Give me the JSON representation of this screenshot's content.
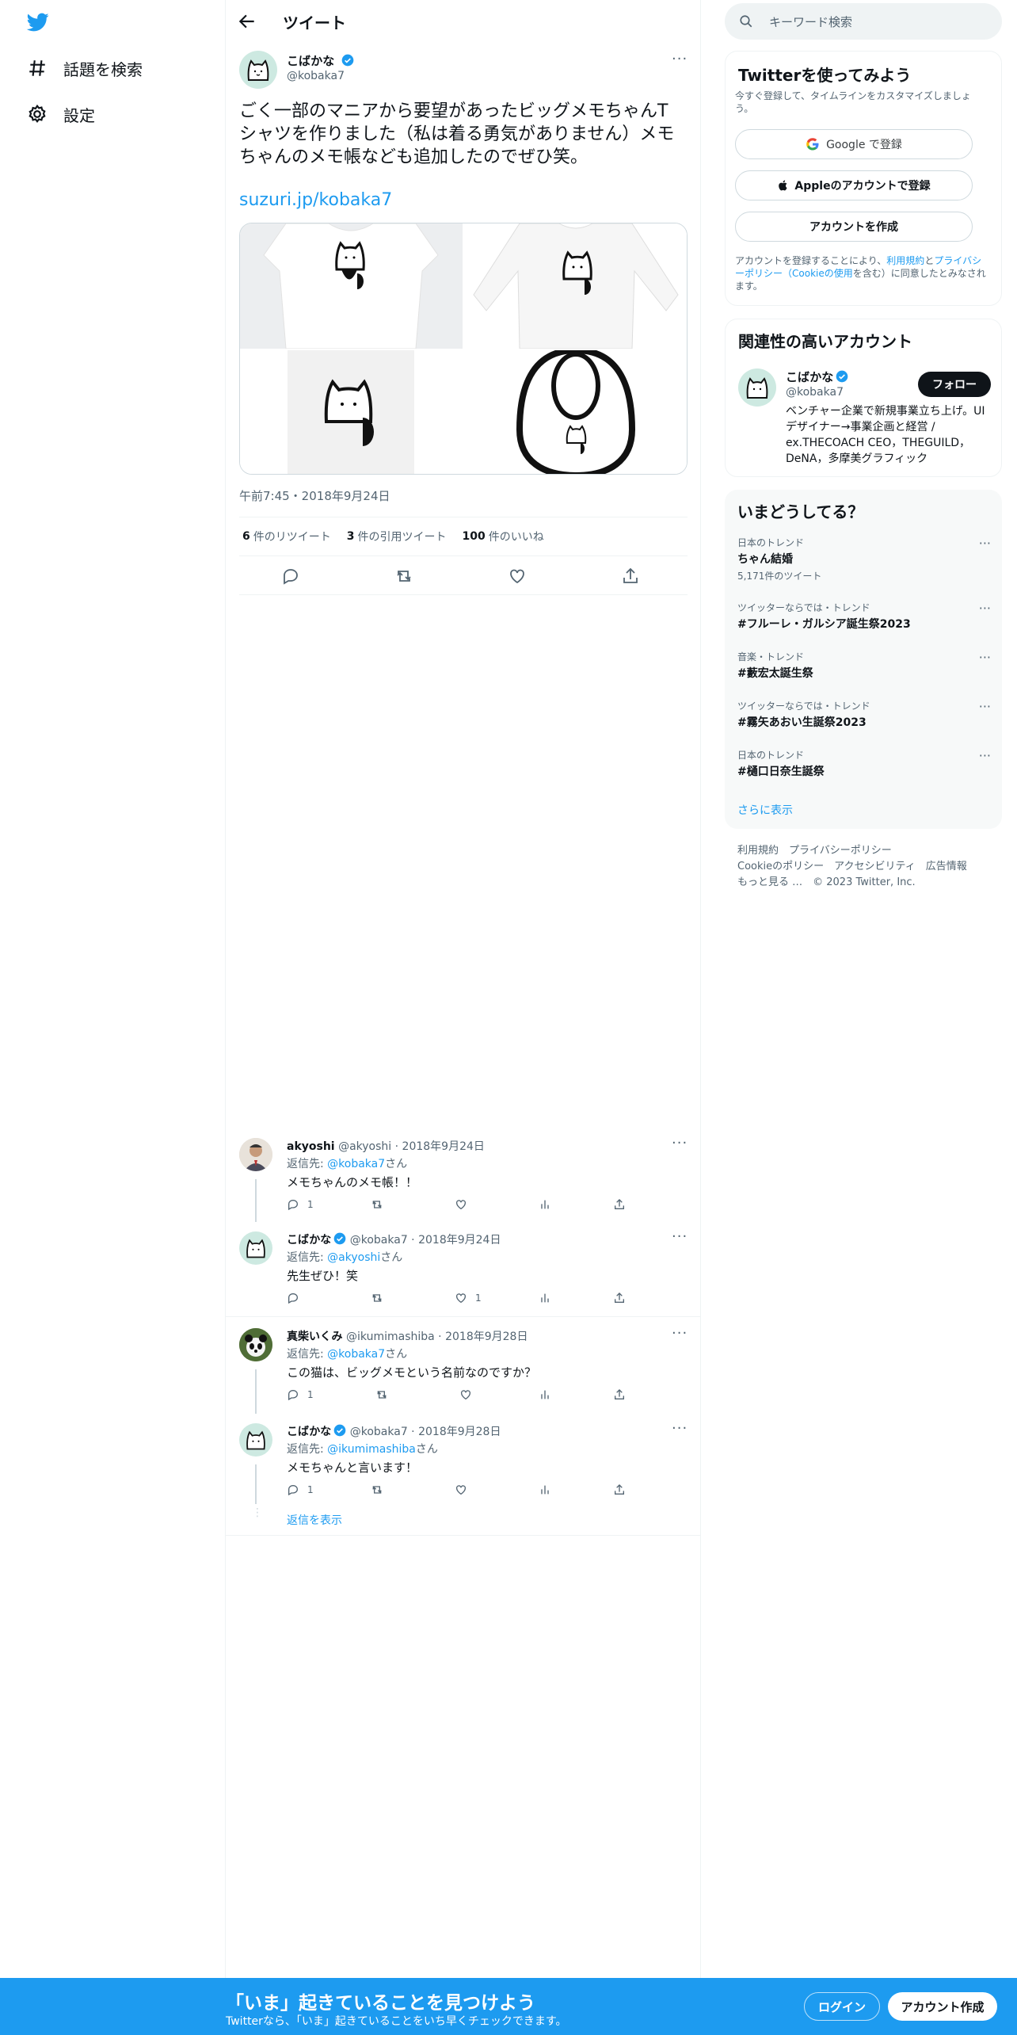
{
  "nav": {
    "explore_label": "話題を検索",
    "settings_label": "設定"
  },
  "header": {
    "title": "ツイート"
  },
  "tweet": {
    "author_name": "こばかな",
    "author_handle": "@kobaka7",
    "text": "ごく一部のマニアから要望があったビッグメモちゃんTシャツを作りました（私は着る勇気がありません）メモちゃんのメモ帳なども追加したのでぜひ笑。",
    "link": "suzuri.jp/kobaka7",
    "timestamp": "午前7:45・2018年9月24日",
    "retweets": "6",
    "retweets_label": "件のリツイート",
    "quotes": "3",
    "quotes_label": "件の引用ツイート",
    "likes": "100",
    "likes_label": "件のいいね",
    "more_label": "···"
  },
  "replies": [
    {
      "name": "akyoshi",
      "handle": "@akyoshi",
      "date": "2018年9月24日",
      "reply_to_prefix": "返信先: ",
      "reply_to": "@kobaka7",
      "reply_to_suffix": "さん",
      "text": "メモちゃんのメモ帳！！",
      "reply_count": "1",
      "retweet_count": "",
      "like_count": ""
    },
    {
      "name": "こばかな",
      "handle": "@kobaka7",
      "date": "2018年9月24日",
      "reply_to_prefix": "返信先: ",
      "reply_to": "@akyoshi",
      "reply_to_suffix": "さん",
      "text": "先生ぜひ！笑",
      "reply_count": "",
      "retweet_count": "",
      "like_count": "1"
    },
    {
      "name": "真柴いくみ",
      "handle": "@ikumimashiba",
      "date": "2018年9月28日",
      "reply_to_prefix": "返信先: ",
      "reply_to": "@kobaka7",
      "reply_to_suffix": "さん",
      "text": "この猫は、ビッグメモという名前なのですか？",
      "reply_count": "1",
      "retweet_count": "",
      "like_count": ""
    },
    {
      "name": "こばかな",
      "handle": "@kobaka7",
      "date": "2018年9月28日",
      "reply_to_prefix": "返信先: ",
      "reply_to": "@ikumimashiba",
      "reply_to_suffix": "さん",
      "text": "メモちゃんと言います！",
      "reply_count": "1",
      "retweet_count": "",
      "like_count": ""
    }
  ],
  "show_replies_label": "返信を表示",
  "right": {
    "search_placeholder": "キーワード検索",
    "signup_box": {
      "title": "Twitterを使ってみよう",
      "subtitle": "今すぐ登録して、タイムラインをカスタマイズしましょう。",
      "google_label": "Google で登録",
      "apple_label": "Appleのアカウントで登録",
      "create_label": "アカウントを作成",
      "terms_prefix": "アカウントを登録することにより、",
      "terms_link": "利用規約",
      "terms_and": "と",
      "privacy_link": "プライバシーポリシー",
      "terms_paren_open": "（",
      "cookie_link": "Cookieの使用",
      "terms_suffix": "を含む）に同意したとみなされます。"
    },
    "related": {
      "title": "関連性の高いアカウント",
      "name": "こばかな",
      "handle": "@kobaka7",
      "follow_label": "フォロー",
      "bio": "ベンチャー企業で新規事業立ち上げ。UIデザイナー→事業企画と経営 / ex.THECOACH CEO，THEGUILD，DeNA，多摩美グラフィック"
    },
    "trends": {
      "title": "いまどうしてる？",
      "items": [
        {
          "meta": "日本のトレンド",
          "name": "ちゃん結婚",
          "count": "5,171件のツイート"
        },
        {
          "meta": "ツイッターならでは・トレンド",
          "name": "#フルーレ・ガルシア誕生祭2023",
          "count": ""
        },
        {
          "meta": "音楽・トレンド",
          "name": "#藪宏太誕生祭",
          "count": ""
        },
        {
          "meta": "ツイッターならでは・トレンド",
          "name": "#霧矢あおい生誕祭2023",
          "count": ""
        },
        {
          "meta": "日本のトレンド",
          "name": "#樋口日奈生誕祭",
          "count": ""
        }
      ],
      "show_more": "さらに表示"
    },
    "footer": {
      "line1": "利用規約　プライバシーポリシー",
      "line2": "Cookieのポリシー　アクセシビリティ　広告情報",
      "line3": "もっと見る …　© 2023 Twitter, Inc."
    }
  },
  "bottom_bar": {
    "title": "「いま」起きていることを見つけよう",
    "subtitle": "Twitterなら、「いま」起きていることをいち早くチェックできます。",
    "login": "ログイン",
    "signup": "アカウント作成"
  },
  "colors": {
    "accent": "#1d9bf0",
    "text": "#0f1419",
    "secondary": "#536471"
  }
}
